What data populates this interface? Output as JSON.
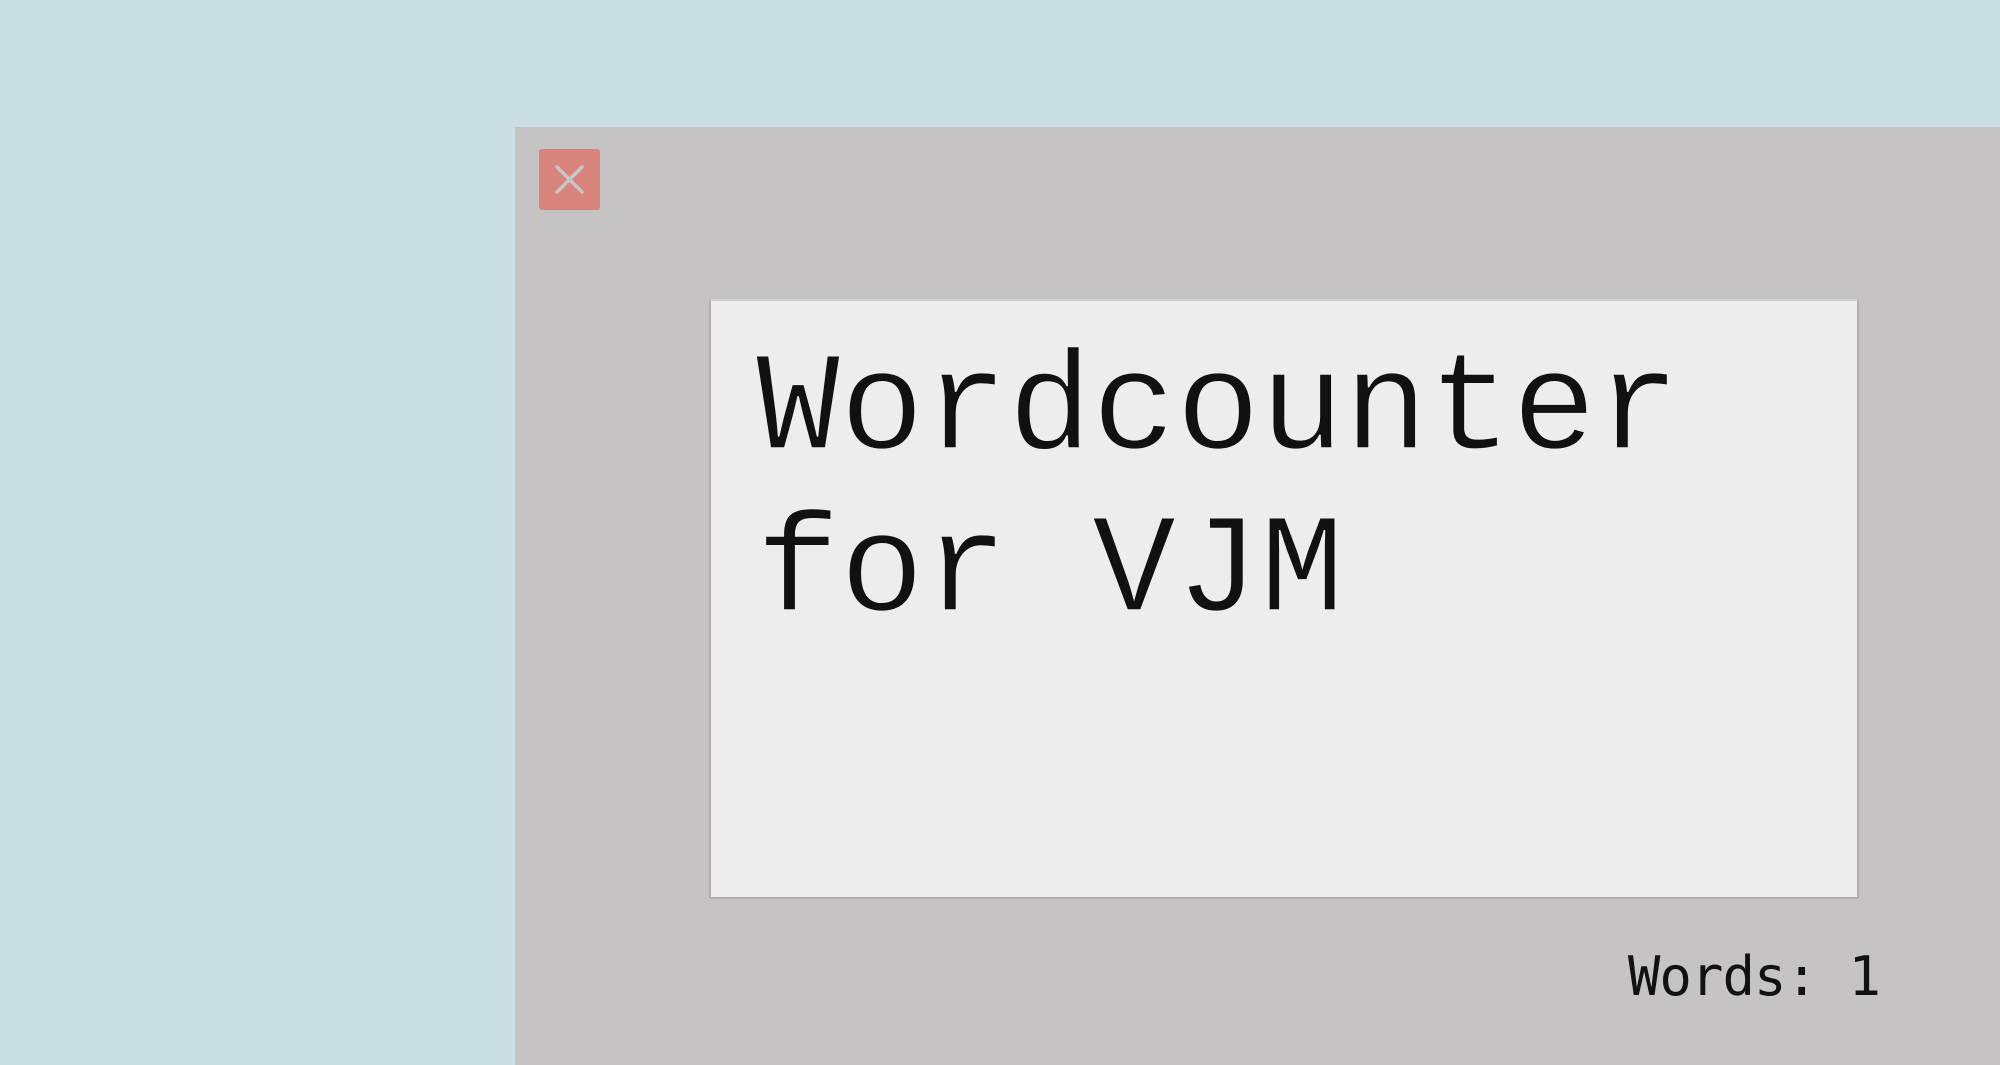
{
  "window": {
    "close_icon": "close-icon"
  },
  "editor": {
    "content": "Wordcounter for VJM"
  },
  "status": {
    "word_count_label": "Words: 1"
  },
  "colors": {
    "desktop_background": "#c9dfe3",
    "window_background": "#c5c3c4",
    "editor_background": "#ededed",
    "close_button": "#d9837d",
    "text": "#111111"
  }
}
